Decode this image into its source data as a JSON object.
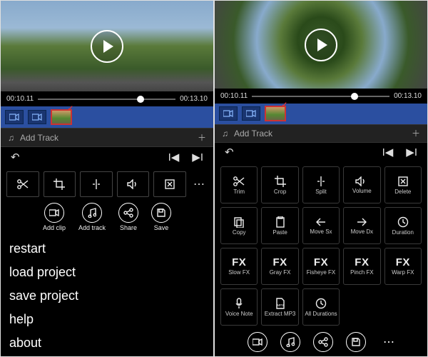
{
  "left": {
    "time_start": "00:10.11",
    "time_end": "00:13.10",
    "audio_label": "Add Track",
    "toolbar": [
      {
        "name": "trim",
        "glyph": "scissors"
      },
      {
        "name": "crop",
        "glyph": "crop"
      },
      {
        "name": "split",
        "glyph": "split"
      },
      {
        "name": "volume",
        "glyph": "volume"
      },
      {
        "name": "delete",
        "glyph": "delete"
      }
    ],
    "actions": [
      {
        "name": "add-clip",
        "label": "Add clip",
        "glyph": "camera"
      },
      {
        "name": "add-track",
        "label": "Add track",
        "glyph": "music"
      },
      {
        "name": "share",
        "label": "Share",
        "glyph": "share"
      },
      {
        "name": "save",
        "label": "Save",
        "glyph": "save"
      }
    ],
    "menu": [
      {
        "name": "restart",
        "label": "restart"
      },
      {
        "name": "load-project",
        "label": "load project"
      },
      {
        "name": "save-project",
        "label": "save project"
      },
      {
        "name": "help",
        "label": "help"
      },
      {
        "name": "about",
        "label": "about"
      }
    ]
  },
  "right": {
    "time_start": "00:10.11",
    "time_end": "00:13.10",
    "audio_label": "Add Track",
    "grid": [
      {
        "name": "trim",
        "label": "Trim",
        "glyph": "scissors"
      },
      {
        "name": "crop",
        "label": "Crop",
        "glyph": "crop"
      },
      {
        "name": "split",
        "label": "Split",
        "glyph": "split"
      },
      {
        "name": "volume",
        "label": "Volume",
        "glyph": "volume"
      },
      {
        "name": "delete",
        "label": "Delete",
        "glyph": "delete"
      },
      {
        "name": "copy",
        "label": "Copy",
        "glyph": "copy"
      },
      {
        "name": "paste",
        "label": "Paste",
        "glyph": "paste"
      },
      {
        "name": "move-sx",
        "label": "Move Sx",
        "glyph": "left"
      },
      {
        "name": "move-dx",
        "label": "Move Dx",
        "glyph": "right"
      },
      {
        "name": "duration",
        "label": "Duration",
        "glyph": "clock"
      },
      {
        "name": "slow-fx",
        "label": "Slow FX",
        "glyph": "FX"
      },
      {
        "name": "gray-fx",
        "label": "Gray FX",
        "glyph": "FX"
      },
      {
        "name": "fisheye-fx",
        "label": "Fisheye FX",
        "glyph": "FX"
      },
      {
        "name": "pinch-fx",
        "label": "Pinch FX",
        "glyph": "FX"
      },
      {
        "name": "warp-fx",
        "label": "Warp FX",
        "glyph": "FX"
      },
      {
        "name": "voice-note",
        "label": "Voice Note",
        "glyph": "mic"
      },
      {
        "name": "extract-mp3",
        "label": "Extract MP3",
        "glyph": "mp3"
      },
      {
        "name": "all-durations",
        "label": "All Durations",
        "glyph": "clock"
      }
    ],
    "bottom_actions": [
      {
        "name": "add-clip",
        "glyph": "camera"
      },
      {
        "name": "add-track",
        "glyph": "music"
      },
      {
        "name": "share",
        "glyph": "share"
      },
      {
        "name": "save",
        "glyph": "save"
      }
    ]
  }
}
